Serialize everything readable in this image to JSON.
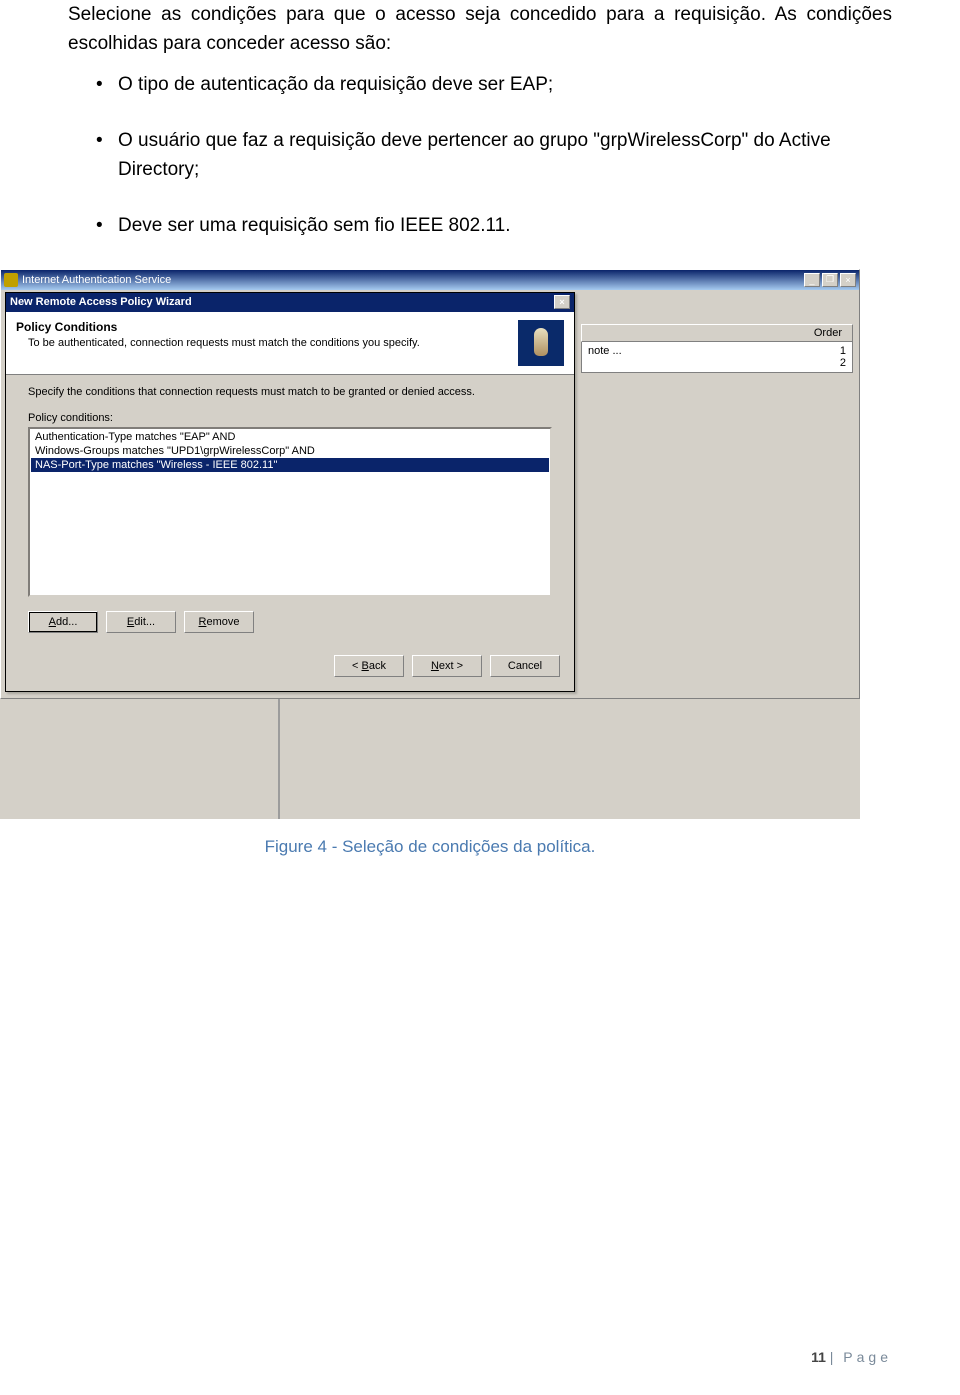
{
  "doc": {
    "p1": "Selecione as condições para que o acesso seja concedido para a requisição. As condições escolhidas para conceder acesso são:",
    "bullets": [
      "O tipo de autenticação da requisição deve ser EAP;",
      "O usuário que faz a requisição deve pertencer ao grupo \"grpWirelessCorp\" do Active Directory;",
      "Deve ser uma requisição sem fio IEEE 802.11."
    ],
    "caption": "Figure 4 - Seleção de condições da política."
  },
  "mmc": {
    "title": "Internet Authentication Service"
  },
  "wizard": {
    "title": "New Remote Access Policy Wizard",
    "heading": "Policy Conditions",
    "sub": "To be authenticated, connection requests must match the conditions you specify.",
    "instr": "Specify the conditions that connection requests must match to be granted or denied access.",
    "field_label": "Policy conditions:",
    "conditions": [
      "Authentication-Type matches \"EAP\" AND",
      "Windows-Groups matches \"UPD1\\grpWirelessCorp\" AND",
      "NAS-Port-Type matches \"Wireless - IEEE 802.11\""
    ],
    "btn_add": "dd...",
    "btn_edit": "dit...",
    "btn_remove": "emove",
    "btn_back": "ack",
    "btn_next": "ext >",
    "btn_cancel": "Cancel"
  },
  "panel": {
    "col_order": "Order",
    "rows": [
      {
        "name": "note ...",
        "order": "1"
      },
      {
        "name": "",
        "order": "2"
      }
    ]
  },
  "footer": {
    "num": "11",
    "sep": " | ",
    "word": "Page"
  }
}
